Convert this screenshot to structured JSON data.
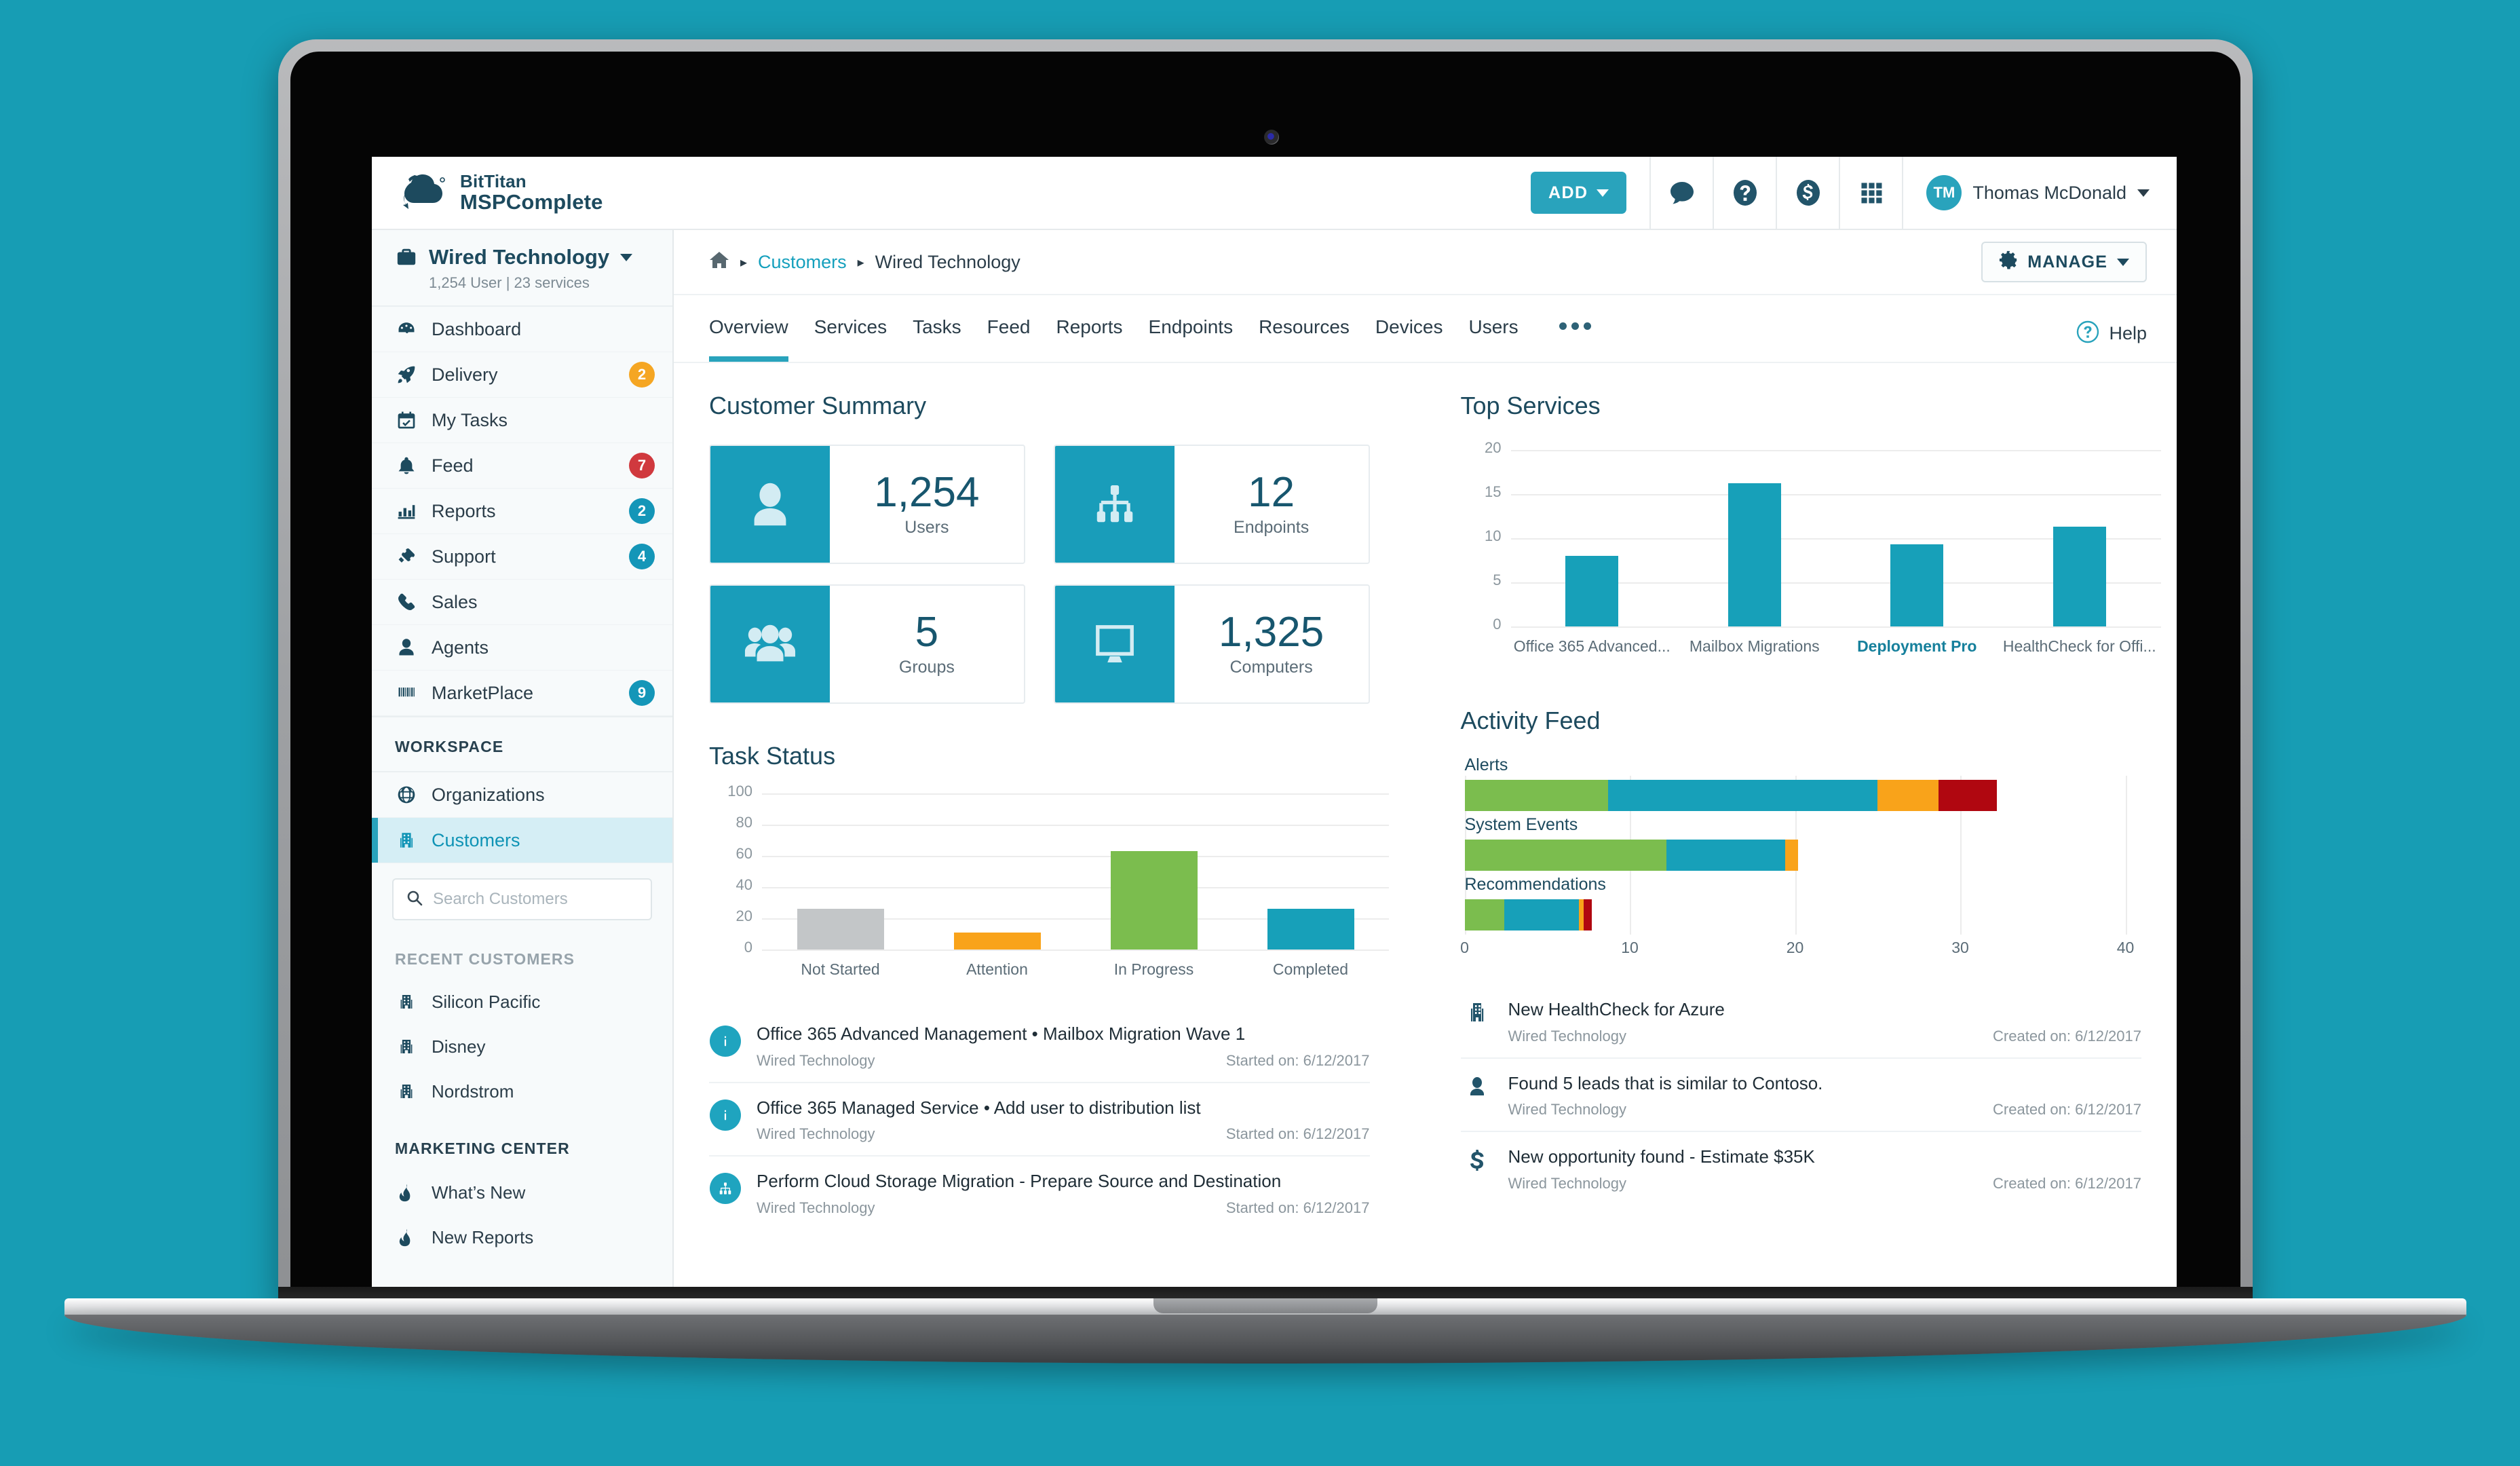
{
  "brand": {
    "line1": "BitTitan",
    "line2": "MSPComplete",
    "logo_icon": "cloud-sync-logo"
  },
  "topbar": {
    "add_label": "ADD",
    "icons": [
      {
        "name": "chat-bubble-icon"
      },
      {
        "name": "help-circle-icon"
      },
      {
        "name": "dollar-circle-icon"
      },
      {
        "name": "app-grid-icon"
      }
    ],
    "user": {
      "initials": "TM",
      "name": "Thomas McDonald"
    }
  },
  "sidebar": {
    "org": {
      "name": "Wired Technology",
      "sub": "1,254 User |  23 services",
      "icon": "briefcase-icon"
    },
    "nav": [
      {
        "label": "Dashboard",
        "icon": "gauge-icon",
        "badge": null,
        "badge_color": null,
        "active": false
      },
      {
        "label": "Delivery",
        "icon": "rocket-icon",
        "badge": "2",
        "badge_color": "#f5a623",
        "active": false
      },
      {
        "label": "My Tasks",
        "icon": "calendar-check-icon",
        "badge": null,
        "badge_color": null,
        "active": false
      },
      {
        "label": "Feed",
        "icon": "bell-icon",
        "badge": "7",
        "badge_color": "#d0393e",
        "active": false
      },
      {
        "label": "Reports",
        "icon": "bar-chart-icon",
        "badge": "2",
        "badge_color": "#1496b8",
        "active": false
      },
      {
        "label": "Support",
        "icon": "ticket-icon",
        "badge": "4",
        "badge_color": "#1496b8",
        "active": false
      },
      {
        "label": "Sales",
        "icon": "phone-icon",
        "badge": null,
        "badge_color": null,
        "active": false
      },
      {
        "label": "Agents",
        "icon": "user-icon",
        "badge": null,
        "badge_color": null,
        "active": false
      },
      {
        "label": "MarketPlace",
        "icon": "barcode-icon",
        "badge": "9",
        "badge_color": "#1496b8",
        "active": false
      }
    ],
    "workspace_label": "WORKSPACE",
    "workspace_items": [
      {
        "label": "Organizations",
        "icon": "globe-icon",
        "active": false
      },
      {
        "label": "Customers",
        "icon": "building-icon",
        "active": true
      }
    ],
    "search": {
      "placeholder": "Search Customers",
      "value": "",
      "icon": "search-icon"
    },
    "recent_label": "RECENT CUSTOMERS",
    "recent_items": [
      {
        "label": "Silicon Pacific",
        "icon": "building-icon"
      },
      {
        "label": "Disney",
        "icon": "building-icon"
      },
      {
        "label": "Nordstrom",
        "icon": "building-icon"
      }
    ],
    "marketing_label": "MARKETING CENTER",
    "marketing_items": [
      {
        "label": "What’s New",
        "icon": "flame-icon"
      },
      {
        "label": "New Reports",
        "icon": "flame-icon"
      }
    ]
  },
  "breadcrumb": {
    "home_icon": "home-icon",
    "link": "Customers",
    "current": "Wired Technology",
    "manage_label": "MANAGE",
    "manage_icon": "gear-icon"
  },
  "tabs": {
    "items": [
      {
        "label": "Overview",
        "active": true
      },
      {
        "label": "Services",
        "active": false
      },
      {
        "label": "Tasks",
        "active": false
      },
      {
        "label": "Feed",
        "active": false
      },
      {
        "label": "Reports",
        "active": false
      },
      {
        "label": "Endpoints",
        "active": false
      },
      {
        "label": "Resources",
        "active": false
      },
      {
        "label": "Devices",
        "active": false
      },
      {
        "label": "Users",
        "active": false
      }
    ],
    "overflow_icon": "ellipsis-icon",
    "help_label": "Help",
    "help_icon": "help-circle-icon"
  },
  "customer_summary": {
    "title": "Customer Summary",
    "cards": [
      {
        "value": "1,254",
        "label": "Users",
        "icon": "user-avatar-icon"
      },
      {
        "value": "12",
        "label": "Endpoints",
        "icon": "sitemap-icon"
      },
      {
        "value": "5",
        "label": "Groups",
        "icon": "users-group-icon"
      },
      {
        "value": "1,325",
        "label": "Computers",
        "icon": "monitor-icon"
      }
    ]
  },
  "chart_data": [
    {
      "id": "top_services",
      "type": "bar",
      "title": "Top Services",
      "categories": [
        "Office 365 Advanced...",
        "Mailbox Migrations",
        "Deployment Pro",
        "HealthCheck for Offi..."
      ],
      "values": [
        8.0,
        16.2,
        9.3,
        11.3
      ],
      "highlighted_category": "Deployment Pro",
      "xlabel": "",
      "ylabel": "",
      "ylim": [
        0,
        20
      ],
      "yticks": [
        0,
        5,
        10,
        15,
        20
      ],
      "grid": true,
      "legend": "none",
      "bar_color": "#17a0b9"
    },
    {
      "id": "task_status",
      "type": "bar",
      "title": "Task Status",
      "categories": [
        "Not Started",
        "Attention",
        "In Progress",
        "Completed"
      ],
      "values": [
        26,
        11,
        63,
        26
      ],
      "colors": [
        "#c3c6c8",
        "#f9a31a",
        "#7bbd4e",
        "#17a0b9"
      ],
      "xlabel": "",
      "ylabel": "",
      "ylim": [
        0,
        100
      ],
      "yticks": [
        0,
        20,
        40,
        60,
        80,
        100
      ],
      "grid": true,
      "legend": "none"
    },
    {
      "id": "activity_feed",
      "type": "bar",
      "orientation": "horizontal",
      "stacked": true,
      "title": "Activity Feed",
      "categories": [
        "Alerts",
        "System Events",
        "Recommendations"
      ],
      "series": [
        {
          "name": "green",
          "color": "#7bbd4e",
          "values": [
            8.7,
            12.2,
            2.4
          ]
        },
        {
          "name": "teal",
          "color": "#17a0b9",
          "values": [
            16.3,
            7.2,
            4.5
          ]
        },
        {
          "name": "orange",
          "color": "#f9a31a",
          "values": [
            3.7,
            0.8,
            0.3
          ]
        },
        {
          "name": "red",
          "color": "#b00710",
          "values": [
            3.5,
            0,
            0.5
          ]
        }
      ],
      "xlabel": "",
      "ylabel": "",
      "xlim": [
        0,
        40
      ],
      "xticks": [
        0,
        10,
        20,
        30,
        40
      ],
      "grid": true,
      "legend": "none"
    }
  ],
  "task_list": [
    {
      "title": "Office 365 Advanced Management • Mailbox Migration Wave 1",
      "sub": "Wired Technology",
      "date": "Started on: 6/12/2017",
      "icon": "info-circle-icon",
      "icon_style": "circle"
    },
    {
      "title": "Office 365 Managed Service • Add user to distribution list",
      "sub": "Wired Technology",
      "date": "Started on: 6/12/2017",
      "icon": "info-circle-icon",
      "icon_style": "circle"
    },
    {
      "title": "Perform Cloud Storage Migration - Prepare Source and Destination",
      "sub": "Wired Technology",
      "date": "Started on: 6/12/2017",
      "icon": "sitemap-circle-icon",
      "icon_style": "circle"
    }
  ],
  "activity_list": [
    {
      "title": "New HealthCheck for Azure",
      "sub": "Wired Technology",
      "date": "Created on: 6/12/2017",
      "icon": "building-icon",
      "icon_style": "plain"
    },
    {
      "title": "Found 5 leads that is similar to Contoso.",
      "sub": "Wired Technology",
      "date": "Created on: 6/12/2017",
      "icon": "user-icon",
      "icon_style": "plain"
    },
    {
      "title": "New opportunity found - Estimate $35K",
      "sub": "Wired Technology",
      "date": "Created on: 6/12/2017",
      "icon": "dollar-icon",
      "icon_style": "plain"
    }
  ],
  "colors": {
    "accent": "#29a3bc",
    "brand_dark": "#1d4a5e",
    "green": "#7bbd4e",
    "orange": "#f9a31a",
    "red": "#d0393e",
    "grey": "#c3c6c8",
    "page_bg": "#179db4"
  }
}
